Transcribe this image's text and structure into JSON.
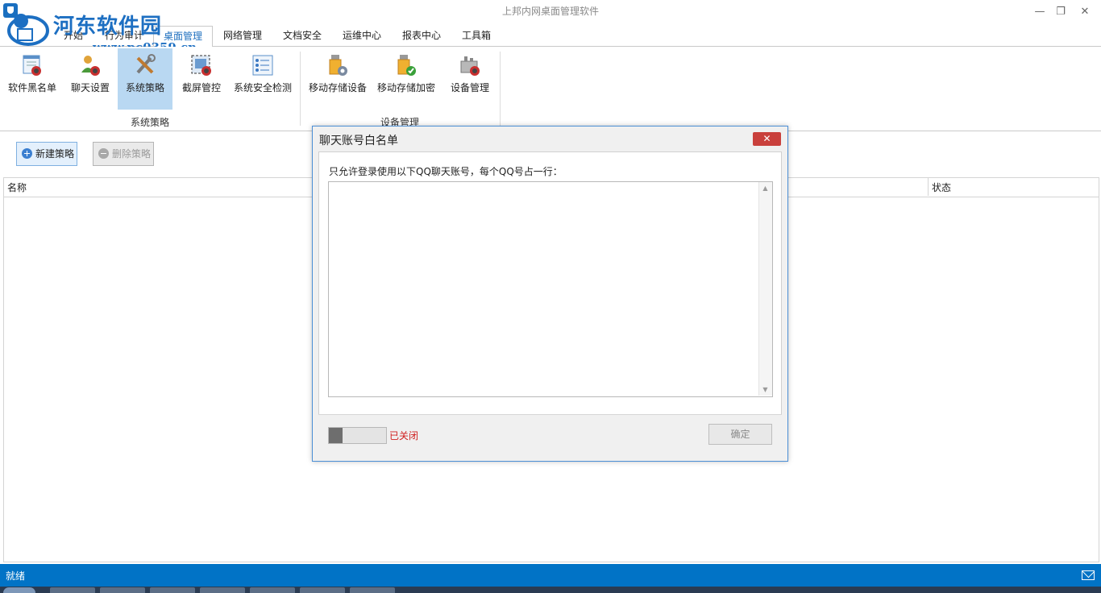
{
  "window": {
    "title": "上邦内网桌面管理软件",
    "min_glyph": "—",
    "restore_glyph": "❐",
    "close_glyph": "✕"
  },
  "watermark": {
    "text": "河东软件园",
    "url": "www.pc0359.cn"
  },
  "tabs": [
    {
      "label": "开始"
    },
    {
      "label": "行为审计"
    },
    {
      "label": "桌面管理"
    },
    {
      "label": "网络管理"
    },
    {
      "label": "文档安全"
    },
    {
      "label": "运维中心"
    },
    {
      "label": "报表中心"
    },
    {
      "label": "工具箱"
    }
  ],
  "ribbon": {
    "buttons": [
      {
        "label": "软件黑名单",
        "icon": "software-blacklist-icon"
      },
      {
        "label": "聊天设置",
        "icon": "chat-settings-icon"
      },
      {
        "label": "系统策略",
        "icon": "tools-icon"
      },
      {
        "label": "截屏管控",
        "icon": "screenshot-control-icon"
      },
      {
        "label": "系统安全检测",
        "icon": "security-check-icon"
      },
      {
        "label": "移动存储设备",
        "icon": "usb-storage-icon"
      },
      {
        "label": "移动存储加密",
        "icon": "usb-encrypt-icon"
      },
      {
        "label": "设备管理",
        "icon": "device-manage-icon"
      }
    ],
    "groups": [
      {
        "label": "系统策略"
      },
      {
        "label": "设备管理"
      }
    ]
  },
  "toolbar": {
    "new_label": "新建策略",
    "delete_label": "删除策略"
  },
  "table": {
    "col_name": "名称",
    "col_status": "状态"
  },
  "status": {
    "text": "就绪"
  },
  "dialog": {
    "title": "聊天账号白名单",
    "close_glyph": "✕",
    "instruction": "只允许登录使用以下QQ聊天账号，每个QQ号占一行：",
    "textarea_value": "",
    "scroll_up": "▲",
    "scroll_down": "▼",
    "toggle_label": "已关闭",
    "ok_label": "确定"
  },
  "colors": {
    "accent": "#0173c6",
    "selected": "#b9d8f2",
    "close_red": "#c9403c",
    "off_red": "#d02020"
  }
}
